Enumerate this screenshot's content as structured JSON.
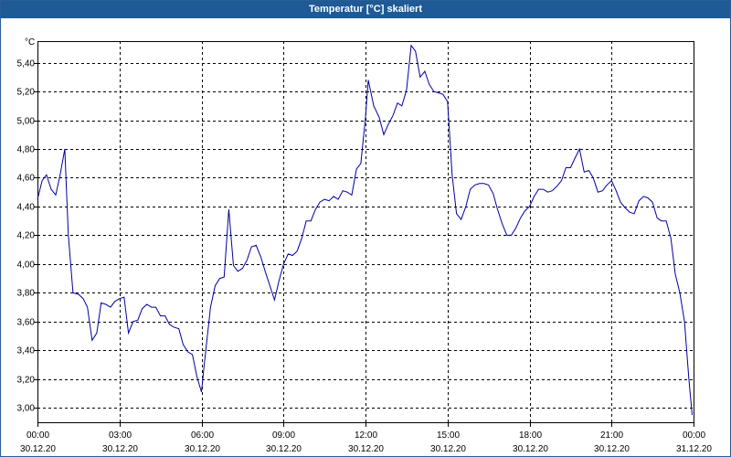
{
  "window": {
    "title": "Temperatur [°C] skaliert"
  },
  "chart_data": {
    "type": "line",
    "title": "Temperatur [°C] skaliert",
    "ylabel": "°C",
    "xlabel": "",
    "ylim": [
      2.9,
      5.55
    ],
    "xlim": [
      0,
      24
    ],
    "grid": true,
    "yticks": [
      3.0,
      3.2,
      3.4,
      3.6,
      3.8,
      4.0,
      4.2,
      4.4,
      4.6,
      4.8,
      5.0,
      5.2,
      5.4
    ],
    "ytick_labels": [
      "3,00",
      "3,20",
      "3,40",
      "3,60",
      "3,80",
      "4,00",
      "4,20",
      "4,40",
      "4,60",
      "4,80",
      "5,00",
      "5,20",
      "5,40"
    ],
    "xticks": [
      0,
      3,
      6,
      9,
      12,
      15,
      18,
      21,
      24
    ],
    "xtick_labels": [
      {
        "time": "00:00",
        "date": "30.12.20"
      },
      {
        "time": "03:00",
        "date": "30.12.20"
      },
      {
        "time": "06:00",
        "date": "30.12.20"
      },
      {
        "time": "09:00",
        "date": "30.12.20"
      },
      {
        "time": "12:00",
        "date": "30.12.20"
      },
      {
        "time": "15:00",
        "date": "30.12.20"
      },
      {
        "time": "18:00",
        "date": "30.12.20"
      },
      {
        "time": "21:00",
        "date": "30.12.20"
      },
      {
        "time": "00:00",
        "date": "31.12.20"
      }
    ],
    "colors": {
      "line": "#0000a0",
      "grid": "#000000",
      "titlebar": "#1d5a96"
    },
    "series": [
      {
        "points": [
          [
            0.0,
            4.45
          ],
          [
            0.17,
            4.58
          ],
          [
            0.33,
            4.62
          ],
          [
            0.5,
            4.52
          ],
          [
            0.67,
            4.48
          ],
          [
            0.83,
            4.62
          ],
          [
            1.0,
            4.8
          ],
          [
            1.13,
            4.2
          ],
          [
            1.3,
            3.8
          ],
          [
            1.5,
            3.79
          ],
          [
            1.67,
            3.76
          ],
          [
            1.83,
            3.7
          ],
          [
            2.0,
            3.47
          ],
          [
            2.17,
            3.52
          ],
          [
            2.33,
            3.73
          ],
          [
            2.5,
            3.72
          ],
          [
            2.67,
            3.7
          ],
          [
            2.83,
            3.74
          ],
          [
            3.0,
            3.76
          ],
          [
            3.17,
            3.77
          ],
          [
            3.33,
            3.52
          ],
          [
            3.5,
            3.6
          ],
          [
            3.67,
            3.61
          ],
          [
            3.83,
            3.69
          ],
          [
            4.0,
            3.72
          ],
          [
            4.17,
            3.7
          ],
          [
            4.33,
            3.7
          ],
          [
            4.5,
            3.64
          ],
          [
            4.67,
            3.64
          ],
          [
            4.83,
            3.58
          ],
          [
            5.0,
            3.56
          ],
          [
            5.17,
            3.55
          ],
          [
            5.33,
            3.44
          ],
          [
            5.5,
            3.39
          ],
          [
            5.67,
            3.37
          ],
          [
            5.83,
            3.22
          ],
          [
            6.0,
            3.11
          ],
          [
            6.1,
            3.3
          ],
          [
            6.33,
            3.7
          ],
          [
            6.5,
            3.85
          ],
          [
            6.67,
            3.9
          ],
          [
            6.83,
            3.91
          ],
          [
            7.0,
            4.38
          ],
          [
            7.17,
            3.99
          ],
          [
            7.33,
            3.95
          ],
          [
            7.5,
            3.97
          ],
          [
            7.67,
            4.03
          ],
          [
            7.83,
            4.12
          ],
          [
            8.0,
            4.13
          ],
          [
            8.17,
            4.05
          ],
          [
            8.33,
            3.95
          ],
          [
            8.5,
            3.85
          ],
          [
            8.67,
            3.75
          ],
          [
            8.83,
            3.88
          ],
          [
            9.0,
            4.0
          ],
          [
            9.17,
            4.07
          ],
          [
            9.33,
            4.06
          ],
          [
            9.5,
            4.09
          ],
          [
            9.67,
            4.18
          ],
          [
            9.83,
            4.3
          ],
          [
            10.0,
            4.3
          ],
          [
            10.17,
            4.38
          ],
          [
            10.33,
            4.43
          ],
          [
            10.5,
            4.45
          ],
          [
            10.67,
            4.44
          ],
          [
            10.83,
            4.47
          ],
          [
            11.0,
            4.45
          ],
          [
            11.17,
            4.51
          ],
          [
            11.33,
            4.5
          ],
          [
            11.5,
            4.48
          ],
          [
            11.67,
            4.66
          ],
          [
            11.83,
            4.7
          ],
          [
            12.0,
            5.02
          ],
          [
            12.1,
            5.28
          ],
          [
            12.3,
            5.1
          ],
          [
            12.5,
            5.02
          ],
          [
            12.67,
            4.9
          ],
          [
            12.83,
            4.97
          ],
          [
            13.0,
            5.03
          ],
          [
            13.17,
            5.12
          ],
          [
            13.33,
            5.1
          ],
          [
            13.5,
            5.21
          ],
          [
            13.67,
            5.52
          ],
          [
            13.83,
            5.48
          ],
          [
            14.0,
            5.3
          ],
          [
            14.17,
            5.34
          ],
          [
            14.33,
            5.25
          ],
          [
            14.5,
            5.2
          ],
          [
            14.67,
            5.19
          ],
          [
            14.83,
            5.18
          ],
          [
            15.0,
            5.13
          ],
          [
            15.17,
            4.62
          ],
          [
            15.33,
            4.35
          ],
          [
            15.5,
            4.31
          ],
          [
            15.67,
            4.4
          ],
          [
            15.83,
            4.52
          ],
          [
            16.0,
            4.55
          ],
          [
            16.17,
            4.56
          ],
          [
            16.33,
            4.56
          ],
          [
            16.5,
            4.55
          ],
          [
            16.67,
            4.49
          ],
          [
            16.83,
            4.38
          ],
          [
            17.0,
            4.28
          ],
          [
            17.17,
            4.2
          ],
          [
            17.33,
            4.2
          ],
          [
            17.5,
            4.25
          ],
          [
            17.67,
            4.32
          ],
          [
            17.83,
            4.37
          ],
          [
            18.0,
            4.4
          ],
          [
            18.17,
            4.47
          ],
          [
            18.33,
            4.52
          ],
          [
            18.5,
            4.52
          ],
          [
            18.67,
            4.5
          ],
          [
            18.83,
            4.51
          ],
          [
            19.0,
            4.54
          ],
          [
            19.17,
            4.58
          ],
          [
            19.33,
            4.67
          ],
          [
            19.5,
            4.67
          ],
          [
            19.67,
            4.74
          ],
          [
            19.83,
            4.8
          ],
          [
            20.0,
            4.64
          ],
          [
            20.17,
            4.65
          ],
          [
            20.33,
            4.6
          ],
          [
            20.5,
            4.5
          ],
          [
            20.67,
            4.51
          ],
          [
            20.83,
            4.55
          ],
          [
            21.0,
            4.58
          ],
          [
            21.17,
            4.51
          ],
          [
            21.33,
            4.43
          ],
          [
            21.5,
            4.39
          ],
          [
            21.67,
            4.36
          ],
          [
            21.83,
            4.35
          ],
          [
            22.0,
            4.44
          ],
          [
            22.17,
            4.47
          ],
          [
            22.33,
            4.46
          ],
          [
            22.5,
            4.43
          ],
          [
            22.67,
            4.32
          ],
          [
            22.83,
            4.3
          ],
          [
            23.0,
            4.3
          ],
          [
            23.17,
            4.18
          ],
          [
            23.33,
            3.93
          ],
          [
            23.5,
            3.8
          ],
          [
            23.67,
            3.6
          ],
          [
            23.83,
            3.2
          ],
          [
            23.95,
            2.95
          ]
        ]
      }
    ]
  }
}
